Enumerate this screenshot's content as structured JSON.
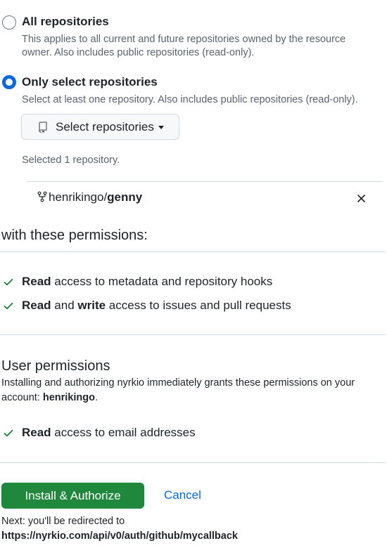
{
  "repository_access": {
    "all": {
      "title": "All repositories",
      "description_line1": "This applies to all current and future repositories owned by the resource",
      "description_line2": "owner. Also includes public repositories (read-only)."
    },
    "select": {
      "title": "Only select repositories",
      "description": "Select at least one repository. Also includes public repositories (read-only).",
      "button_label": "Select repositories",
      "selected_count_text": "Selected 1 repository."
    },
    "selected_repo": {
      "owner": "henrikingo/",
      "name": "genny"
    }
  },
  "permissions": {
    "heading": "with these permissions:",
    "items": [
      {
        "bold1": "Read",
        "text1": " access to metadata and repository hooks"
      },
      {
        "bold1": "Read",
        "text1": " and ",
        "bold2": "write",
        "text2": " access to issues and pull requests"
      }
    ]
  },
  "user_permissions": {
    "heading": "User permissions",
    "description_line1": "Installing and authorizing nyrkio immediately grants these permissions on your",
    "description_prefix": "account: ",
    "account": "henrikingo",
    "description_suffix": ".",
    "items": [
      {
        "bold1": "Read",
        "text1": " access to email addresses"
      }
    ]
  },
  "actions": {
    "install_label": "Install & Authorize",
    "cancel_label": "Cancel",
    "next_text": "Next: you'll be redirected to",
    "redirect_url": "https://nyrkio.com/api/v0/auth/github/mycallback"
  },
  "colors": {
    "accent_blue": "#0969da",
    "install_green": "#1f883d",
    "check_green": "#1a7f37"
  }
}
